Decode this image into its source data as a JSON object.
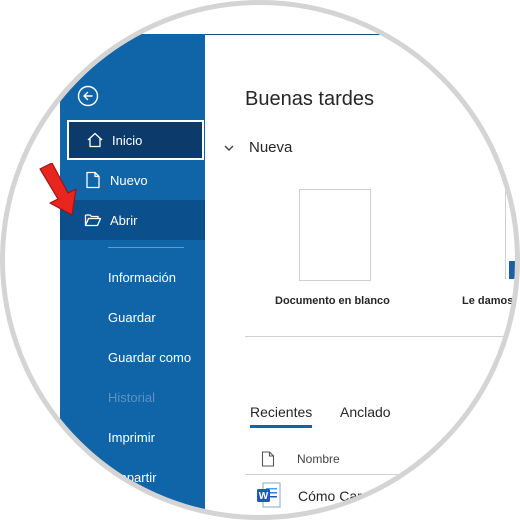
{
  "sidebar": {
    "nav": [
      {
        "label": "Inicio",
        "icon": "home-icon"
      },
      {
        "label": "Nuevo",
        "icon": "new-document-icon"
      },
      {
        "label": "Abrir",
        "icon": "open-folder-icon"
      }
    ],
    "sub": [
      {
        "label": "Información"
      },
      {
        "label": "Guardar"
      },
      {
        "label": "Guardar como"
      },
      {
        "label": "Historial",
        "disabled": true
      },
      {
        "label": "Imprimir"
      },
      {
        "label": "mpartir"
      }
    ]
  },
  "main": {
    "greeting": "Buenas tardes",
    "new_section": "Nueva",
    "templates": [
      "Documento en blanco",
      "Le damos"
    ],
    "tabs": [
      "Recientes",
      "Anclado"
    ],
    "column_name": "Nombre",
    "recent_files": [
      {
        "name": "Cómo Car"
      }
    ]
  },
  "colors": {
    "sidebar": "#0f65a8",
    "active": "#0c3b6b",
    "arrow": "#e8251f"
  }
}
